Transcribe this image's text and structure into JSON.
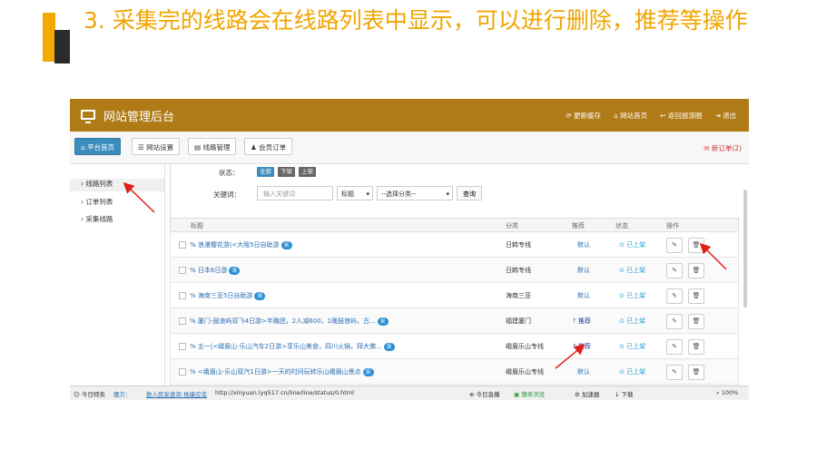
{
  "slide": {
    "title": "3. 采集完的线路会在线路列表中显示，可以进行删除，推荐等操作"
  },
  "colors": {
    "accent_gold": "#f2a900",
    "header_brown": "#b07a17",
    "link_blue": "#2a6fb5"
  },
  "header": {
    "site_title": "网站管理后台",
    "links": [
      "更新缓存",
      "网站首页",
      "返回旅游圈",
      "退出"
    ]
  },
  "nav": {
    "buttons": [
      "平台首页",
      "网站设置",
      "线路管理",
      "会员订单"
    ],
    "new_order": "新订单(2)"
  },
  "sidebar": {
    "items": [
      "线路列表",
      "订单列表",
      "采集线路"
    ]
  },
  "filter": {
    "status_label": "状态：",
    "status_tags": [
      "全部",
      "下架",
      "上架"
    ],
    "keyword_label": "关键词：",
    "keyword_placeholder": "输入关键词",
    "field_select": "标题",
    "category_select": "--选择分类--",
    "search_button": "查询"
  },
  "table": {
    "headers": [
      "标题",
      "分类",
      "推荐",
      "状态",
      "操作"
    ],
    "badge": "采",
    "rows": [
      {
        "title": "% 浪漫樱花游|<大阪5日自助游",
        "category": "日韩专线",
        "recommend": "默认",
        "status": "已上架"
      },
      {
        "title": "% 日本6日游",
        "category": "日韩专线",
        "recommend": "默认",
        "status": "已上架"
      },
      {
        "title": "% 海南三亚5日自助游",
        "category": "海南三亚",
        "recommend": "默认",
        "status": "已上架"
      },
      {
        "title": "% 厦门-鼓浪屿双飞4日游>半晚团，2人减600，1晚鼓浪屿，古...",
        "category": "福建厦门",
        "recommend": "推荐",
        "status": "已上架"
      },
      {
        "title": "% 五一|<峨眉山-乐山汽车2日游>享乐山美食，四川火锅，拜大佛...",
        "category": "峨眉乐山专线",
        "recommend": "推荐",
        "status": "已上架"
      },
      {
        "title": "% <峨眉山-乐山双汽1日游>一天的时间玩转乐山峨眉山景点",
        "category": "峨眉乐山专线",
        "recommend": "默认",
        "status": "已上架"
      }
    ]
  },
  "statusbar": {
    "today": "今日特卖",
    "tip": "魔方：",
    "tip_link": "数人民家查询 杨康应变",
    "url": "http://xinyuan.lyq517.cn/line/line/status/0.html",
    "live": "今日直播",
    "browser": "猜奇浏览",
    "accel": "加速器",
    "download": "下载",
    "zoom": "100%"
  }
}
